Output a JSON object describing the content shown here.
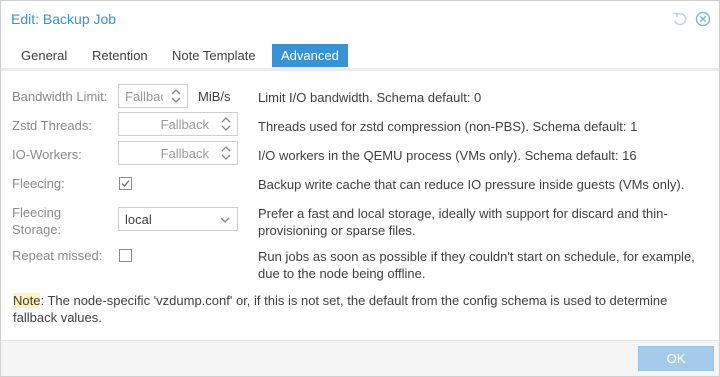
{
  "window": {
    "title": "Edit: Backup Job"
  },
  "header_tools": {
    "reset_icon": "reset-icon",
    "close_icon": "close-icon"
  },
  "tabs": [
    {
      "label": "General",
      "active": false
    },
    {
      "label": "Retention",
      "active": false
    },
    {
      "label": "Note Template",
      "active": false
    },
    {
      "label": "Advanced",
      "active": true
    }
  ],
  "rows": {
    "bandwidth": {
      "label": "Bandwidth Limit:",
      "placeholder": "Fallback",
      "unit": "MiB/s",
      "description": "Limit I/O bandwidth. Schema default: 0"
    },
    "zstd": {
      "label": "Zstd Threads:",
      "placeholder": "Fallback",
      "description": "Threads used for zstd compression (non-PBS). Schema default: 1"
    },
    "ioworkers": {
      "label": "IO-Workers:",
      "placeholder": "Fallback",
      "description": "I/O workers in the QEMU process (VMs only). Schema default: 16"
    },
    "fleecing": {
      "label": "Fleecing:",
      "checked": true,
      "description": "Backup write cache that can reduce IO pressure inside guests (VMs only)."
    },
    "fleecing_storage": {
      "label_line1": "Fleecing",
      "label_line2": "Storage:",
      "value": "local",
      "description": "Prefer a fast and local storage, ideally with support for discard and thin-provisioning or sparse files."
    },
    "repeat_missed": {
      "label": "Repeat missed:",
      "checked": false,
      "description": "Run jobs as soon as possible if they couldn't start on schedule, for example, due to the node being offline."
    }
  },
  "note": {
    "label": "Note",
    "text": ": The node-specific 'vzdump.conf' or, if this is not set, the default from the config schema is used to determine fallback values."
  },
  "footer": {
    "ok_label": "OK",
    "ok_enabled": false
  },
  "colors": {
    "accent": "#3892d4",
    "ok_disabled": "#a4cbe9",
    "note_highlight": "#fff3b5"
  }
}
